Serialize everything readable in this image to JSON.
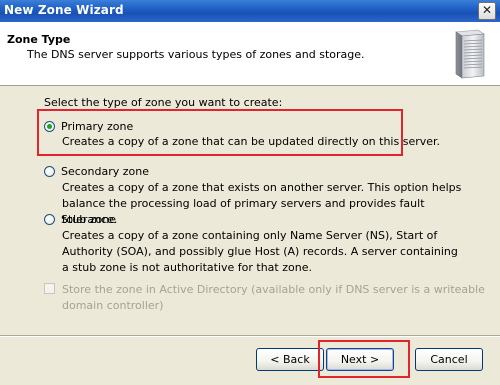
{
  "window": {
    "title": "New Zone Wizard",
    "close_label": "✕"
  },
  "header": {
    "title": "Zone Type",
    "subtitle": "The DNS server supports various types of zones and storage."
  },
  "prompt": "Select the type of zone you want to create:",
  "options": [
    {
      "label": "Primary zone",
      "description": "Creates a copy of a zone that can be updated directly on this server.",
      "selected": true
    },
    {
      "label": "Secondary zone",
      "description": "Creates a copy of a zone that exists on another server. This option helps balance the processing load of primary servers and provides fault tolerance.",
      "selected": false
    },
    {
      "label": "Stub zone",
      "description": "Creates a copy of a zone containing only Name Server (NS), Start of Authority (SOA), and possibly glue Host (A) records. A server containing a stub zone is not authoritative for that zone.",
      "selected": false
    }
  ],
  "store_in_ad": {
    "label": "Store the zone in Active Directory (available only if DNS server is a writeable domain controller)",
    "checked": false,
    "enabled": false
  },
  "buttons": {
    "back": "< Back",
    "next": "Next >",
    "cancel": "Cancel"
  },
  "colors": {
    "highlight": "#e0262c",
    "titlebar": "#1f5fc4",
    "radio_dot": "#21a121"
  }
}
